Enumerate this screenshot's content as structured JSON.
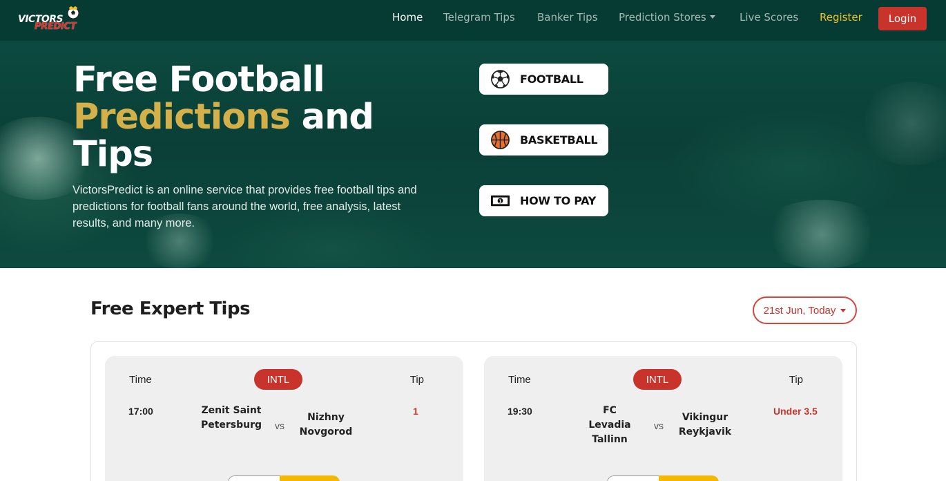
{
  "brand": {
    "logo_top": "VICTORS",
    "logo_bottom": "PREDICT"
  },
  "nav": {
    "items": [
      {
        "label": "Home",
        "active": true
      },
      {
        "label": "Telegram Tips"
      },
      {
        "label": "Banker Tips"
      },
      {
        "label": "Prediction Stores",
        "dropdown": true
      },
      {
        "label": "Live Scores"
      },
      {
        "label": "Register"
      }
    ],
    "login_label": "Login"
  },
  "hero": {
    "title_line1": "Free Football",
    "title_highlight": "Predictions",
    "title_line2_rest": " and",
    "title_line3": "Tips",
    "description": "VictorsPredict is an online service that provides free football tips and predictions for football fans around the world, free analysis, latest results, and many more.",
    "buttons": [
      {
        "label": "FOOTBALL",
        "icon": "soccer-ball-icon"
      },
      {
        "label": "BASKETBALL",
        "icon": "basketball-icon"
      },
      {
        "label": "HOW TO PAY",
        "icon": "money-icon"
      }
    ]
  },
  "tips": {
    "section_title": "Free Expert Tips",
    "date_selector": "21st Jun, Today",
    "header_time": "Time",
    "header_tip": "Tip",
    "vs_label": "vs",
    "cards": [
      {
        "league": "INTL",
        "time": "17:00",
        "home": "Zenit Saint Petersburg",
        "away": "Nizhny Novgorod",
        "tip": "1"
      },
      {
        "league": "INTL",
        "time": "19:30",
        "home": "FC Levadia Tallinn",
        "away": "Vikingur Reykjavik",
        "tip": "Under 3.5"
      }
    ]
  },
  "colors": {
    "nav_bg": "#053b33",
    "accent_red": "#c8342b",
    "gold": "#d4b04a",
    "register_yellow": "#f0c22a"
  }
}
